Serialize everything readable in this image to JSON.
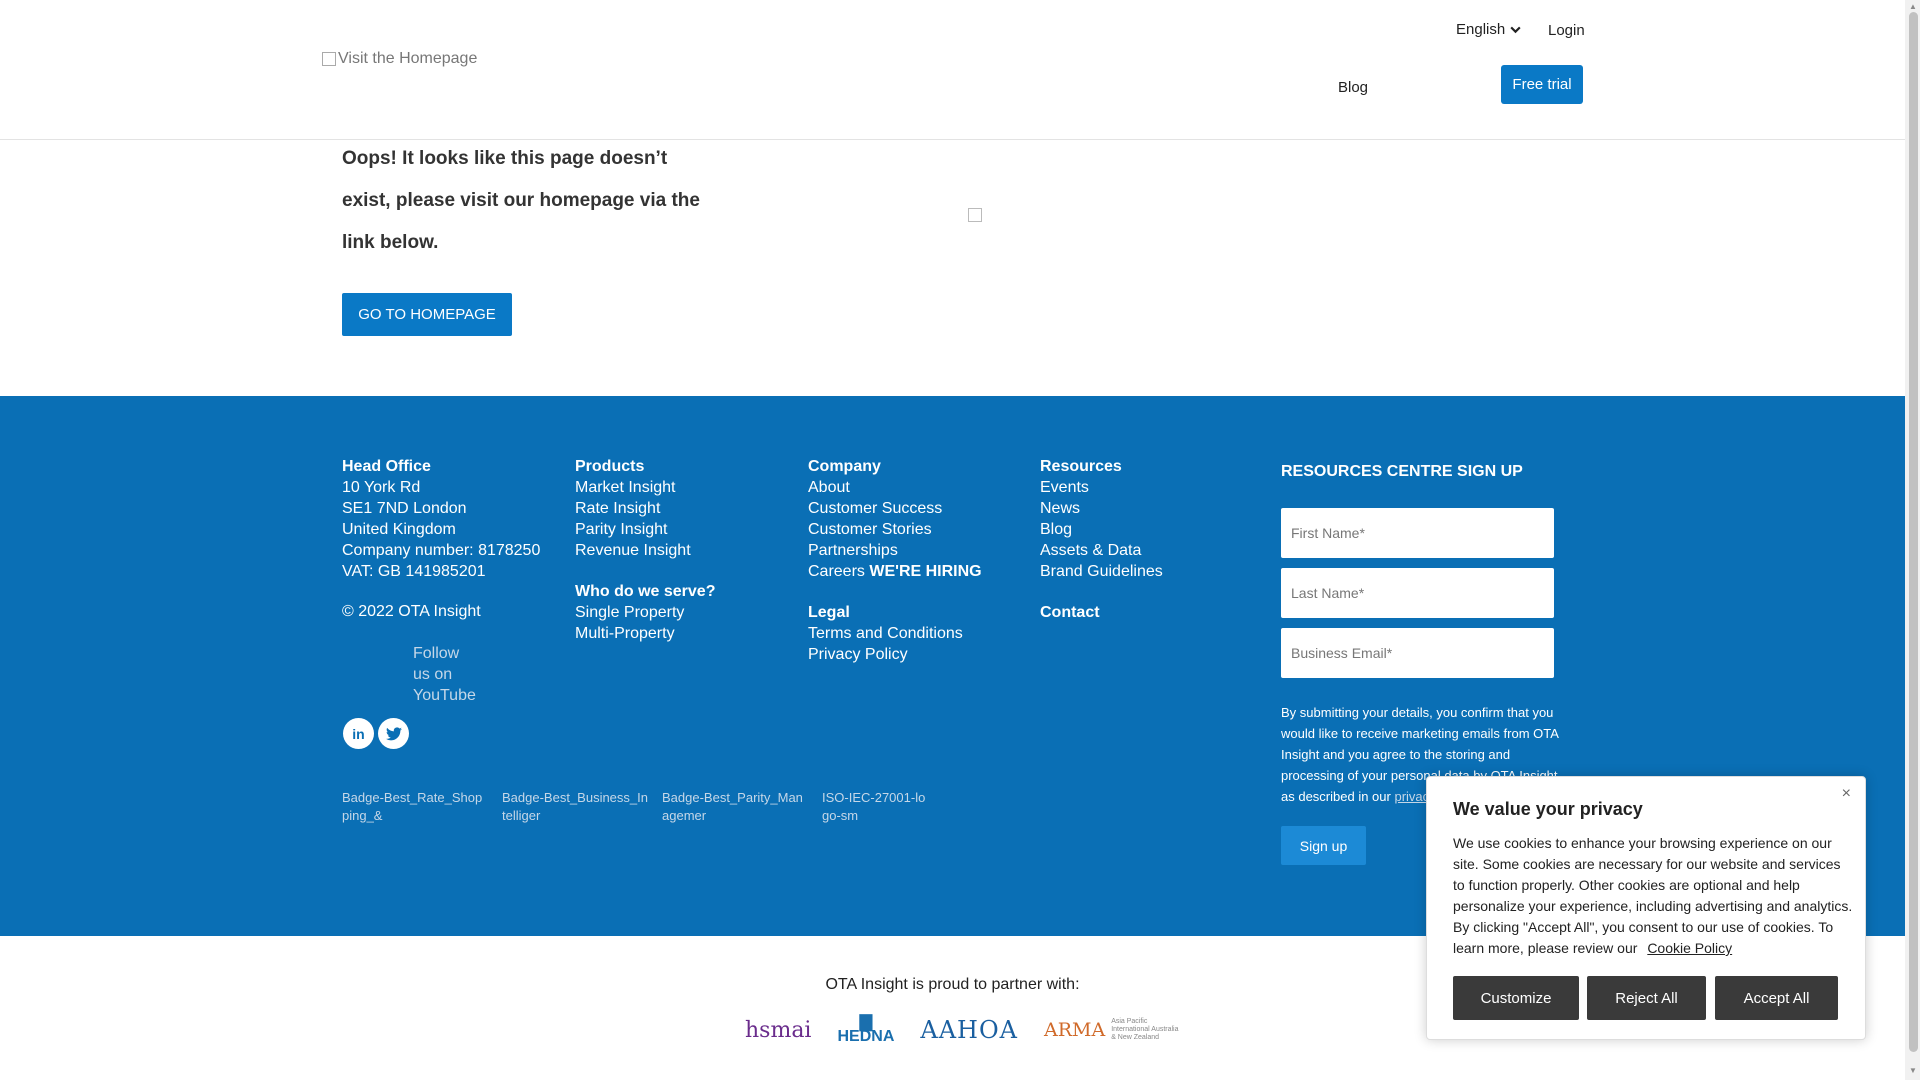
{
  "header": {
    "logo_alt": "Visit the Homepage",
    "language": "English",
    "login": "Login",
    "blog": "Blog",
    "free_trial": "Free trial"
  },
  "main": {
    "error_message": "Oops! It looks like this page doesn’t exist, please visit our homepage via the link below.",
    "home_button": "GO TO HOMEPAGE"
  },
  "footer": {
    "head_office": {
      "title": "Head Office",
      "lines": [
        "10 York Rd",
        "SE1 7ND London",
        "United Kingdom",
        "Company number: 8178250",
        "VAT: GB 141985201"
      ],
      "copyright": "© 2022 OTA Insight",
      "youtube_alt": "Follow us on YouTube"
    },
    "products": {
      "title": "Products",
      "items": [
        "Market Insight",
        "Rate Insight",
        "Parity Insight",
        "Revenue Insight"
      ],
      "serve_title": "Who do we serve?",
      "serve_items": [
        "Single Property",
        "Multi-Property"
      ]
    },
    "company": {
      "title": "Company",
      "items": [
        "About",
        "Customer Success",
        "Customer Stories",
        "Partnerships",
        "Careers"
      ],
      "hiring": "WE'RE HIRING",
      "legal_title": "Legal",
      "legal_items": [
        "Terms and Conditions",
        "Privacy Policy"
      ]
    },
    "resources": {
      "title": "Resources",
      "items": [
        "Events",
        "News",
        "Blog",
        "Assets & Data",
        "Brand Guidelines"
      ],
      "contact": "Contact"
    },
    "badges": [
      "Badge-Best_Rate_Shopping_&",
      "Badge-Best_Business_Intelliger",
      "Badge-Best_Parity_Managemer",
      "ISO-IEC-27001-logo-sm"
    ],
    "signup": {
      "title": "RESOURCES CENTRE SIGN UP",
      "first_name": "First Name*",
      "last_name": "Last Name*",
      "email": "Business Email*",
      "consent": "By submitting your details, you confirm that you would like to receive marketing emails from OTA Insight and you agree to the storing and processing of your personal data by OTA Insight as described in our",
      "privacy_link": "privacy",
      "button": "Sign up"
    }
  },
  "partners": {
    "title": "OTA Insight is proud to partner with:",
    "hsmai": "hsmai",
    "hedna": "HEDNA",
    "aahoa": "AAHOA",
    "arma": "ARMA",
    "arma_sub": "Asia Pacific International Australia & New Zealand"
  },
  "cookie": {
    "title": "We value your privacy",
    "body": "We use cookies to enhance your browsing experience on our site. Some cookies are necessary for our website and services to function properly. Other cookies are optional and help personalize your experience, including advertising and analytics. By clicking \"Accept All\", you consent to our use of cookies. To learn more, please review our",
    "policy_link": "Cookie Policy",
    "customize": "Customize",
    "reject": "Reject All",
    "accept": "Accept All",
    "close_icon": "close-icon"
  },
  "colors": {
    "brand_blue": "#0a79c6",
    "footer_blue": "#0a6fb5",
    "dark_button": "#3a3a3a"
  }
}
